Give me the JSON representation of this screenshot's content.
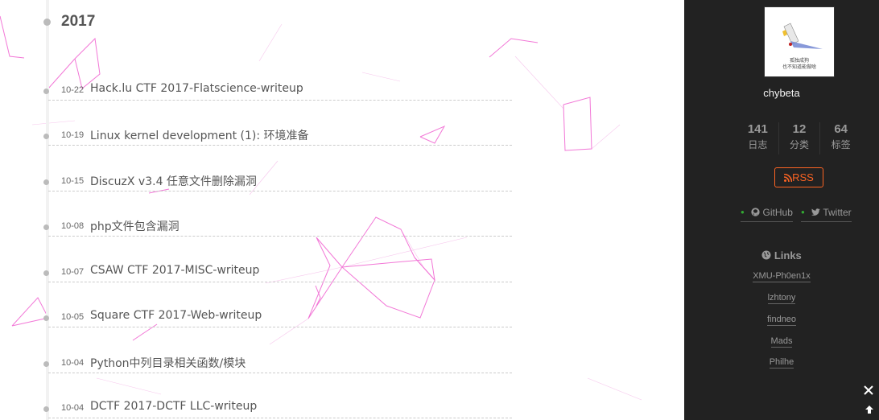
{
  "archive": {
    "year": "2017",
    "posts": [
      {
        "date": "10-22",
        "title": "Hack.lu CTF 2017-Flatscience-writeup"
      },
      {
        "date": "10-19",
        "title": "Linux kernel development (1): 环境准备"
      },
      {
        "date": "10-15",
        "title": "DiscuzX v3.4 任意文件删除漏洞"
      },
      {
        "date": "10-08",
        "title": "php文件包含漏洞"
      },
      {
        "date": "10-07",
        "title": "CSAW CTF 2017-MISC-writeup"
      },
      {
        "date": "10-05",
        "title": "Square CTF 2017-Web-writeup"
      },
      {
        "date": "10-04",
        "title": "Python中列目录相关函数/模块"
      },
      {
        "date": "10-04",
        "title": "DCTF 2017-DCTF LLC-writeup"
      }
    ]
  },
  "sidebar": {
    "avatar_caption_line1": "孤独成狗",
    "avatar_caption_line2": "也不知道能做啥",
    "author": "chybeta",
    "stats": [
      {
        "count": "141",
        "label": "日志"
      },
      {
        "count": "12",
        "label": "分类"
      },
      {
        "count": "64",
        "label": "标签"
      }
    ],
    "rss_label": "RSS",
    "social": [
      {
        "name": "GitHub",
        "icon": "github-icon"
      },
      {
        "name": "Twitter",
        "icon": "twitter-icon"
      }
    ],
    "links_title": "Links",
    "links": [
      "XMU-Ph0en1x",
      "lzhtony",
      "findneo",
      "Mads",
      "Philhe"
    ]
  },
  "colors": {
    "sidebar_bg": "#222222",
    "rss_accent": "#fc6423",
    "canvas_lines": "#ff33cc"
  }
}
